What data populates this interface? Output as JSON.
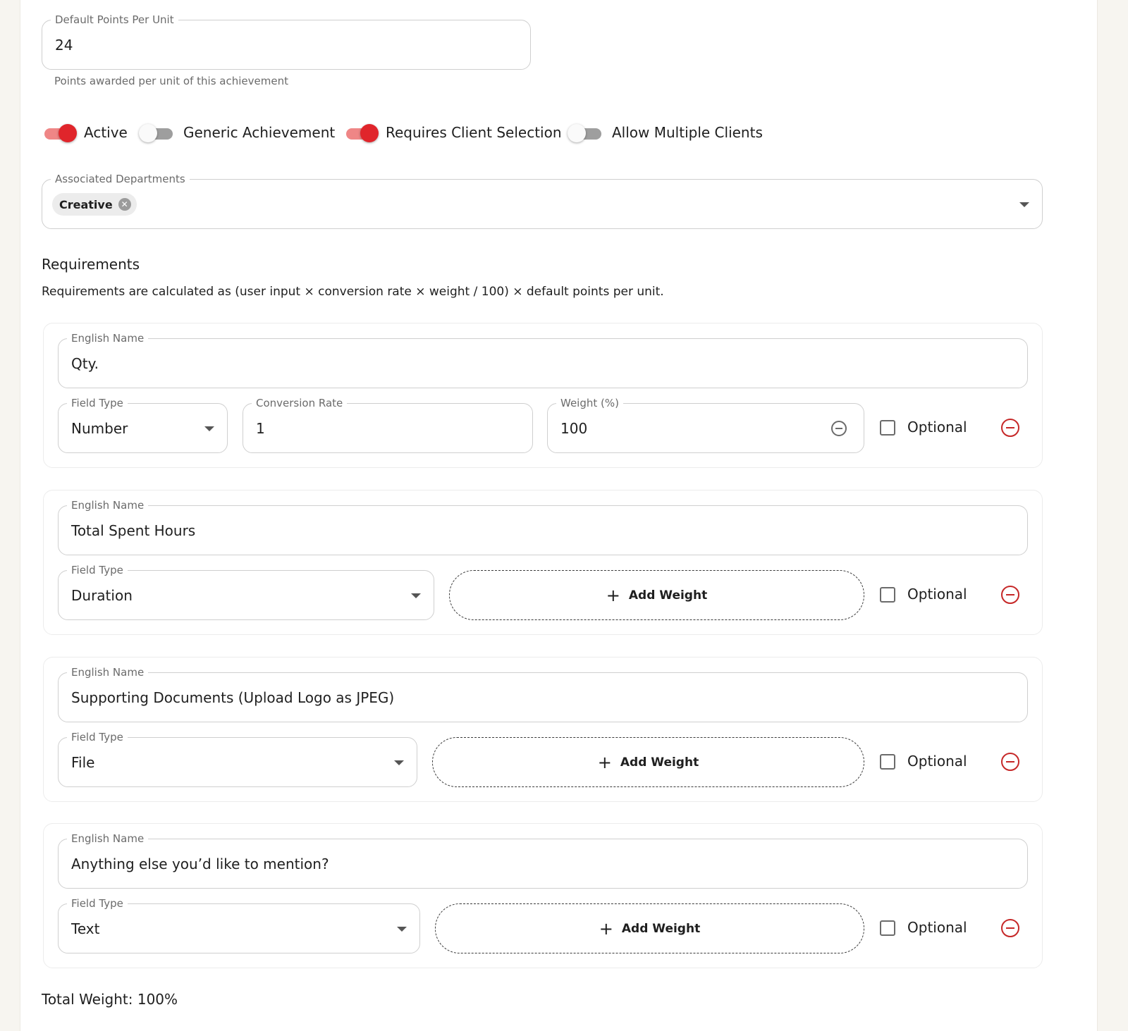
{
  "default_points": {
    "label": "Default Points Per Unit",
    "value": "24",
    "helper": "Points awarded per unit of this achievement"
  },
  "toggles": [
    {
      "label": "Active",
      "on": true
    },
    {
      "label": "Generic Achievement",
      "on": false
    },
    {
      "label": "Requires Client Selection",
      "on": true
    },
    {
      "label": "Allow Multiple Clients",
      "on": false
    }
  ],
  "departments": {
    "label": "Associated Departments",
    "chips": [
      "Creative"
    ]
  },
  "requirements": {
    "title": "Requirements",
    "description": "Requirements are calculated as (user input × conversion rate × weight / 100) × default points per unit.",
    "name_label": "English Name",
    "field_type_label": "Field Type",
    "conversion_label": "Conversion Rate",
    "weight_label": "Weight (%)",
    "optional_label": "Optional",
    "add_weight_label": "Add Weight",
    "items": [
      {
        "name": "Qty.",
        "field_type": "Number",
        "conversion_rate": "1",
        "weight": "100"
      },
      {
        "name": "Total Spent Hours",
        "field_type": "Duration"
      },
      {
        "name": "Supporting Documents (Upload Logo as JPEG)",
        "field_type": "File"
      },
      {
        "name": "Anything else you’d like to mention?",
        "field_type": "Text"
      }
    ]
  },
  "total_weight": "Total Weight: 100%",
  "colors": {
    "accent": "#e0252b",
    "accent_track": "#ef8686",
    "remove": "#c62828"
  }
}
